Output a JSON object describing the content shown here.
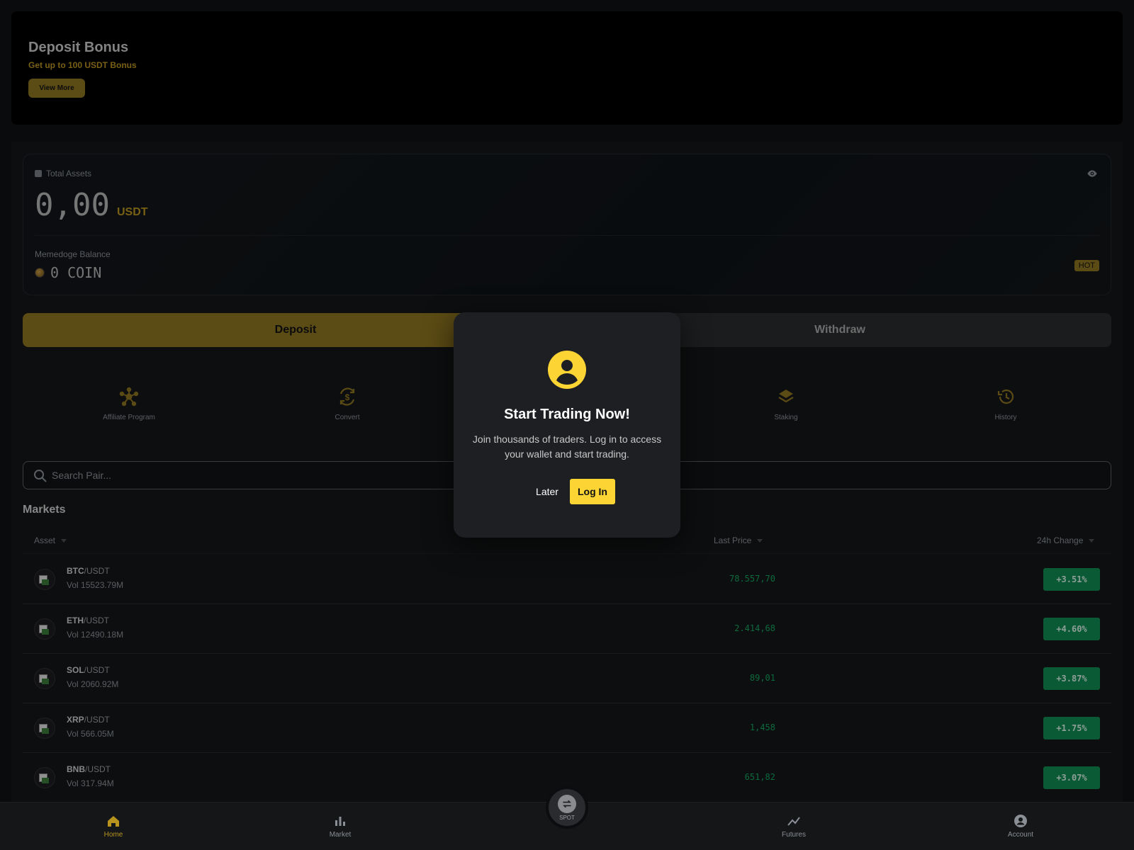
{
  "banner": {
    "title": "Deposit Bonus",
    "subtitle": "Get up to 100 USDT Bonus",
    "button_label": "View More"
  },
  "assets": {
    "label": "Total Assets",
    "value": "0,00",
    "unit": "USDT",
    "memedoge_label": "Memedoge Balance",
    "memedoge_value": "0 COIN",
    "hot_badge": "HOT",
    "icons": [
      "wallet-icon",
      "eye-icon",
      "coin-icon"
    ]
  },
  "actions": {
    "deposit_label": "Deposit",
    "withdraw_label": "Withdraw"
  },
  "quick_actions": [
    {
      "label": "Affiliate Program",
      "icon": "affiliate-icon"
    },
    {
      "label": "Convert",
      "icon": "convert-icon"
    },
    {
      "label": "Staking",
      "icon": "staking-icon"
    },
    {
      "label": "History",
      "icon": "history-icon"
    }
  ],
  "search": {
    "placeholder": "Search Pair..."
  },
  "markets": {
    "title": "Markets",
    "columns": {
      "asset": "Asset",
      "last_price": "Last Price",
      "change": "24h Change"
    },
    "rows": [
      {
        "base": "BTC",
        "quote": "/USDT",
        "vol": "Vol 15523.79M",
        "price": "78.557,70",
        "change": "+3.51%"
      },
      {
        "base": "ETH",
        "quote": "/USDT",
        "vol": "Vol 12490.18M",
        "price": "2.414,68",
        "change": "+4.60%"
      },
      {
        "base": "SOL",
        "quote": "/USDT",
        "vol": "Vol 2060.92M",
        "price": "89,01",
        "change": "+3.87%"
      },
      {
        "base": "XRP",
        "quote": "/USDT",
        "vol": "Vol 566.05M",
        "price": "1,458",
        "change": "+1.75%"
      },
      {
        "base": "BNB",
        "quote": "/USDT",
        "vol": "Vol 317.94M",
        "price": "651,82",
        "change": "+3.07%"
      }
    ]
  },
  "nav": {
    "home": "Home",
    "market": "Market",
    "spot": "SPOT",
    "futures": "Futures",
    "account": "Account",
    "active": "home"
  },
  "modal": {
    "title": "Start Trading Now!",
    "text": "Join thousands of traders. Log in to access your wallet and start trading.",
    "later_label": "Later",
    "login_label": "Log In"
  },
  "colors": {
    "accent": "#fcd535",
    "accent_dim": "#8c7320",
    "positive": "#15a360",
    "positive_badge": "#108a52",
    "background": "#101113"
  }
}
